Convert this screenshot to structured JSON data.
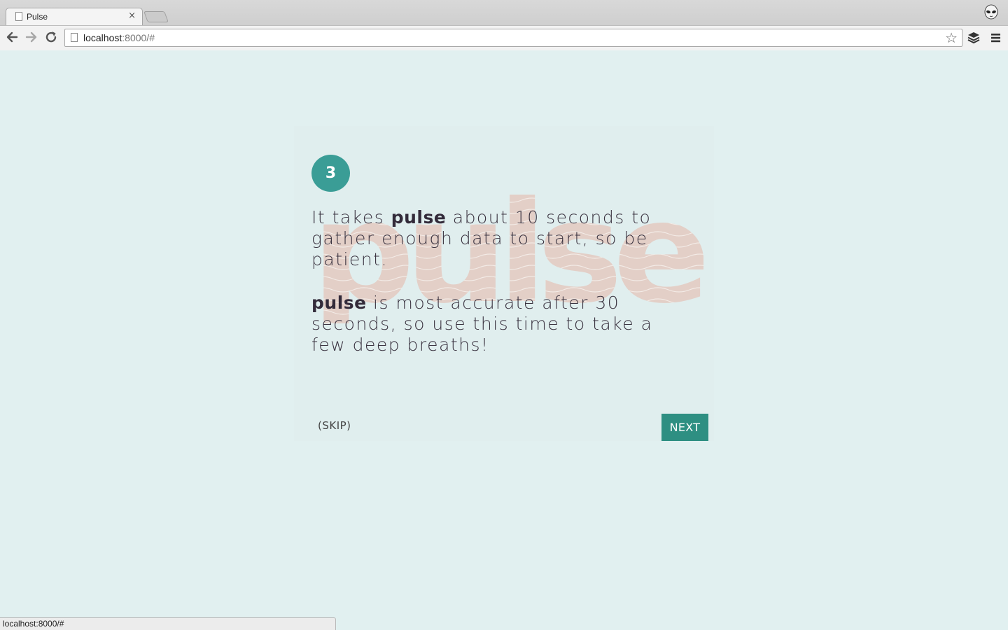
{
  "browser": {
    "tab_title": "Pulse",
    "tab_close": "×",
    "url_host": "localhost",
    "url_rest": ":8000/#",
    "status_text": "localhost:8000/#",
    "icons": [
      "back-icon",
      "forward-icon",
      "reload-icon",
      "page-icon",
      "bookmark-star-icon",
      "layers-icon",
      "menu-icon",
      "alien-profile-icon"
    ]
  },
  "onboarding": {
    "step_number": "3",
    "watermark_text": "pulse",
    "paragraph1": {
      "before": "It takes ",
      "brand": "pulse",
      "after": " about 10 seconds to gather enough data to start, so be patient."
    },
    "paragraph2": {
      "brand": "pulse",
      "after": " is most accurate after 30 seconds, so use this time to take a few deep breaths!"
    },
    "skip_label": "(SKIP)",
    "next_label": "NEXT"
  },
  "colors": {
    "page_bg": "#e1f0f0",
    "accent_teal": "#2e8f82",
    "step_circle": "#3a9d96",
    "text_dark": "#3a3340",
    "watermark": "#e6cdc4"
  }
}
